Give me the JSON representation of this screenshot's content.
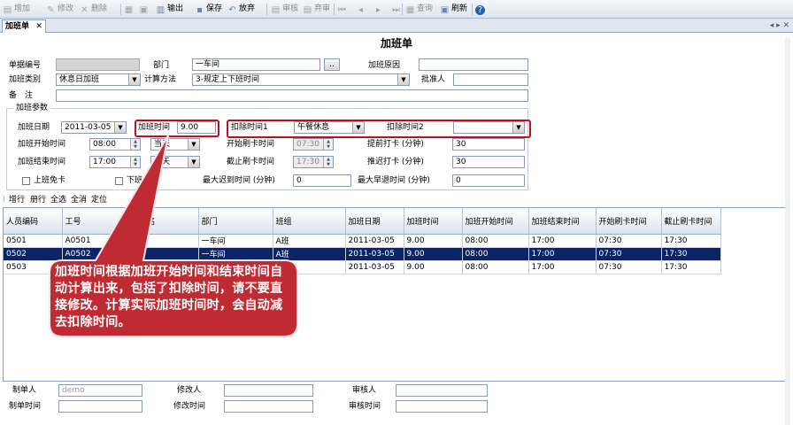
{
  "toolbar": {
    "items": [
      {
        "label": "增加",
        "icon": "add-doc-icon",
        "glyph": "▤",
        "disabled": true
      },
      {
        "label": "修改",
        "icon": "edit-icon",
        "glyph": "✎",
        "disabled": true
      },
      {
        "label": "删除",
        "icon": "delete-icon",
        "glyph": "✕",
        "disabled": true
      },
      {
        "label": "",
        "icon": "print-icon",
        "glyph": "▦",
        "disabled": true
      },
      {
        "label": "",
        "icon": "preview-icon",
        "glyph": "▣",
        "disabled": true
      },
      {
        "label": "输出",
        "icon": "export-icon",
        "glyph": "▥",
        "disabled": false
      },
      {
        "label": "保存",
        "icon": "save-icon",
        "glyph": "▪",
        "disabled": false
      },
      {
        "label": "放弃",
        "icon": "undo-icon",
        "glyph": "↶",
        "disabled": false
      },
      {
        "label": "审核",
        "icon": "audit-icon",
        "glyph": "▤",
        "disabled": true
      },
      {
        "label": "弃审",
        "icon": "unaudit-icon",
        "glyph": "▤",
        "disabled": true
      },
      {
        "label": "",
        "icon": "first-icon",
        "glyph": "⏮",
        "disabled": true
      },
      {
        "label": "",
        "icon": "prev-icon",
        "glyph": "◂",
        "disabled": true
      },
      {
        "label": "",
        "icon": "next-icon",
        "glyph": "▸",
        "disabled": true
      },
      {
        "label": "",
        "icon": "last-icon",
        "glyph": "⏭",
        "disabled": true
      },
      {
        "label": "查询",
        "icon": "query-icon",
        "glyph": "▦",
        "disabled": true
      },
      {
        "label": "刷新",
        "icon": "refresh-icon",
        "glyph": "▣",
        "disabled": false
      },
      {
        "label": "",
        "icon": "help-icon",
        "glyph": "?",
        "disabled": false
      }
    ]
  },
  "tab": {
    "label": "加班单",
    "close": "✕"
  },
  "tab_controls": "◂ ▸ ✕",
  "form": {
    "title": "加班单",
    "doc_no_label": "单据编号",
    "doc_no": "",
    "dept_label": "部门",
    "dept": "一车间",
    "dept_btn": "..",
    "reason_label": "加班原因",
    "reason": "",
    "type_label": "加班类别",
    "type": "休息日加班",
    "calc_label": "计算方法",
    "calc": "3-规定上下班时间",
    "approver_label": "批准人",
    "approver": "",
    "remark_label": "备　注",
    "remark": ""
  },
  "params": {
    "legend": "加班参数",
    "date_label": "加班日期",
    "date": "2011-03-05",
    "ot_label": "加班时间",
    "ot": "9.00",
    "ded1_label": "扣除时间1",
    "ded1": "午餐休息",
    "ded2_label": "扣除时间2",
    "ded2": "",
    "start_label": "加班开始时间",
    "start": "08:00",
    "start_day": "当天",
    "start_swipe_label": "开始刷卡时间",
    "start_swipe": "07:30",
    "early_label": "提前打卡 (分钟)",
    "early": "30",
    "end_label": "加班结束时间",
    "end": "17:00",
    "end_day": "当天",
    "end_swipe_label": "截止刷卡时间",
    "end_swipe": "17:30",
    "late_label": "推迟打卡 (分钟)",
    "late": "30",
    "free_on_label": "上班免卡",
    "free_off_label": "下班免卡",
    "max_late_label": "最大迟到时间 (分钟)",
    "max_late": "0",
    "max_leave_label": "最大早退时间 (分钟)",
    "max_leave": "0"
  },
  "sub_toolbar": [
    "增行",
    "册行",
    "全选",
    "全消",
    "定位"
  ],
  "grid": {
    "columns": [
      "人员编码",
      "工号",
      "姓名",
      "部门",
      "班组",
      "加班日期",
      "加班时间",
      "加班开始时间",
      "加班结束时间",
      "开始刷卡时间",
      "截止刷卡时间"
    ],
    "rows": [
      [
        "0501",
        "A0501",
        "",
        "一车间",
        "A班",
        "2011-03-05",
        "9.00",
        "08:00",
        "17:00",
        "07:30",
        "17:30"
      ],
      [
        "0502",
        "A0502",
        "",
        "一车间",
        "A班",
        "2011-03-05",
        "9.00",
        "08:00",
        "17:00",
        "07:30",
        "17:30"
      ],
      [
        "0503",
        "",
        "",
        "",
        "",
        "2011-03-05",
        "9.00",
        "08:00",
        "17:00",
        "07:30",
        "17:30"
      ]
    ],
    "selected_row": 1
  },
  "callout": {
    "text": "加班时间根据加班开始时间和结束时间自动计算出来，包括了扣除时间，请不要直接修改。计算实际加班时间时，会自动减去扣除时间。",
    "fill": "#c02a32"
  },
  "footer": {
    "creator_label": "制单人",
    "creator": "demo",
    "modifier_label": "修改人",
    "modifier": "",
    "auditor_label": "审核人",
    "auditor": "",
    "create_time_label": "制单时间",
    "create_time": "",
    "modify_time_label": "修改时间",
    "modify_time": "",
    "audit_time_label": "审核时间",
    "audit_time": ""
  }
}
